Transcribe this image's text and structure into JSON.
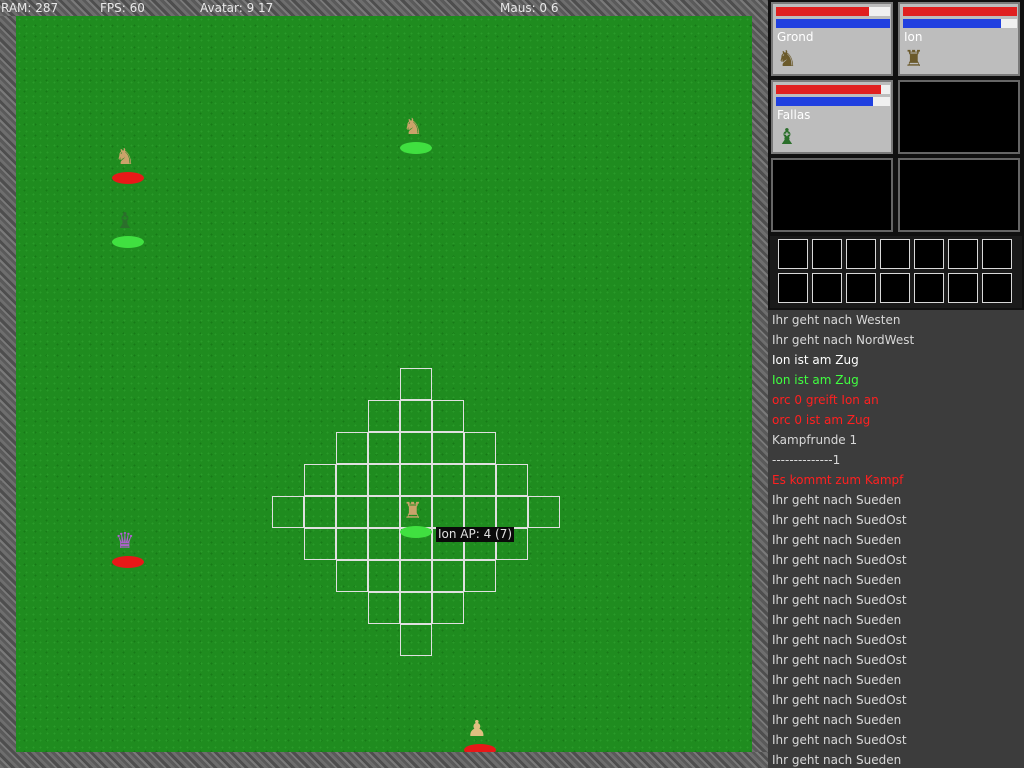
{
  "hud": {
    "ram": "RAM: 287",
    "fps": "FPS: 60",
    "avatar": "Avatar: 9 17",
    "mouse": "Maus: 0 6"
  },
  "tooltip": "Ion AP: 4 (7)",
  "party": [
    {
      "name": "Grond",
      "hp": 0.82,
      "mp": 1.0
    },
    {
      "name": "Ion",
      "hp": 1.0,
      "mp": 0.86
    },
    {
      "name": "Fallas",
      "hp": 0.92,
      "mp": 0.85
    }
  ],
  "log": [
    {
      "text": "Ihr geht nach Westen",
      "color": "#d8d8d8"
    },
    {
      "text": "Ihr geht nach NordWest",
      "color": "#d8d8d8"
    },
    {
      "text": "Ion ist am Zug",
      "color": "#ffffff"
    },
    {
      "text": "Ion ist am Zug",
      "color": "#40ff40"
    },
    {
      "text": "orc 0 greift Ion an",
      "color": "#ff2020"
    },
    {
      "text": "orc 0 ist am Zug",
      "color": "#ff2020"
    },
    {
      "text": "Kampfrunde 1",
      "color": "#d8d8d8"
    },
    {
      "text": "--------------1",
      "color": "#d8d8d8"
    },
    {
      "text": "Es kommt zum Kampf",
      "color": "#ff2020"
    },
    {
      "text": "Ihr geht nach Sueden",
      "color": "#d8d8d8"
    },
    {
      "text": "Ihr geht nach SuedOst",
      "color": "#d8d8d8"
    },
    {
      "text": "Ihr geht nach Sueden",
      "color": "#d8d8d8"
    },
    {
      "text": "Ihr geht nach SuedOst",
      "color": "#d8d8d8"
    },
    {
      "text": "Ihr geht nach Sueden",
      "color": "#d8d8d8"
    },
    {
      "text": "Ihr geht nach SuedOst",
      "color": "#d8d8d8"
    },
    {
      "text": "Ihr geht nach Sueden",
      "color": "#d8d8d8"
    },
    {
      "text": "Ihr geht nach SuedOst",
      "color": "#d8d8d8"
    },
    {
      "text": "Ihr geht nach SuedOst",
      "color": "#d8d8d8"
    },
    {
      "text": "Ihr geht nach Sueden",
      "color": "#d8d8d8"
    },
    {
      "text": "Ihr geht nach SuedOst",
      "color": "#d8d8d8"
    },
    {
      "text": "Ihr geht nach Sueden",
      "color": "#d8d8d8"
    },
    {
      "text": "Ihr geht nach SuedOst",
      "color": "#d8d8d8"
    },
    {
      "text": "Ihr geht nach Sueden",
      "color": "#d8d8d8"
    }
  ],
  "units": [
    {
      "name": "orc-top-left",
      "team": "enemy",
      "icon": "warrior-icon"
    },
    {
      "name": "grond-field",
      "team": "ally",
      "icon": "warrior-icon"
    },
    {
      "name": "fallas-field",
      "team": "ally",
      "icon": "mage-icon"
    },
    {
      "name": "ion-field",
      "team": "ally",
      "icon": "axe-warrior-icon"
    },
    {
      "name": "sorcerer-enemy",
      "team": "enemy",
      "icon": "sorcerer-icon"
    },
    {
      "name": "enemy-bottom",
      "team": "enemy",
      "icon": "fighter-icon"
    }
  ],
  "colors": {
    "ally_base": "#40e040",
    "enemy_base": "#e81818",
    "grass": "#1f8c1f"
  }
}
